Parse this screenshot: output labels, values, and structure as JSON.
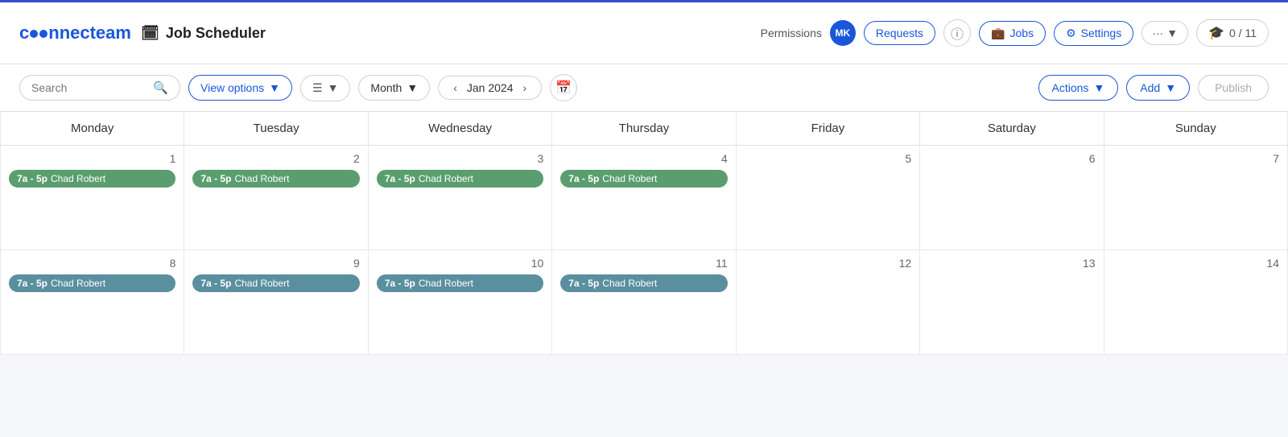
{
  "app": {
    "logo": "connecteam",
    "title": "Job Scheduler"
  },
  "header": {
    "permissions_label": "Permissions",
    "avatar": "MK",
    "requests_btn": "Requests",
    "jobs_btn": "Jobs",
    "settings_btn": "Settings",
    "more_btn": "···",
    "badge_label": "0 / 11"
  },
  "toolbar": {
    "search_placeholder": "Search",
    "view_options_label": "View options",
    "month_label": "Month",
    "nav_date": "Jan 2024",
    "actions_label": "Actions",
    "add_label": "Add",
    "publish_label": "Publish"
  },
  "calendar": {
    "days": [
      "Monday",
      "Tuesday",
      "Wednesday",
      "Thursday",
      "Friday",
      "Saturday",
      "Sunday"
    ],
    "week1": [
      {
        "num": 1,
        "shifts": [
          {
            "time": "7a - 5p",
            "name": "Chad Robert",
            "color": "green"
          }
        ]
      },
      {
        "num": 2,
        "shifts": [
          {
            "time": "7a - 5p",
            "name": "Chad Robert",
            "color": "green"
          }
        ]
      },
      {
        "num": 3,
        "shifts": [
          {
            "time": "7a - 5p",
            "name": "Chad Robert",
            "color": "green"
          }
        ]
      },
      {
        "num": 4,
        "shifts": [
          {
            "time": "7a - 5p",
            "name": "Chad Robert",
            "color": "green"
          }
        ]
      },
      {
        "num": 5,
        "shifts": []
      },
      {
        "num": 6,
        "shifts": []
      },
      {
        "num": 7,
        "shifts": []
      }
    ],
    "week2": [
      {
        "num": 8,
        "shifts": [
          {
            "time": "7a - 5p",
            "name": "Chad Robert",
            "color": "teal"
          }
        ]
      },
      {
        "num": 9,
        "shifts": [
          {
            "time": "7a - 5p",
            "name": "Chad Robert",
            "color": "teal"
          }
        ]
      },
      {
        "num": 10,
        "shifts": [
          {
            "time": "7a - 5p",
            "name": "Chad Robert",
            "color": "teal"
          }
        ]
      },
      {
        "num": 11,
        "shifts": [
          {
            "time": "7a - 5p",
            "name": "Chad Robert",
            "color": "teal"
          }
        ]
      },
      {
        "num": 12,
        "shifts": []
      },
      {
        "num": 13,
        "shifts": []
      },
      {
        "num": 14,
        "shifts": []
      }
    ]
  }
}
